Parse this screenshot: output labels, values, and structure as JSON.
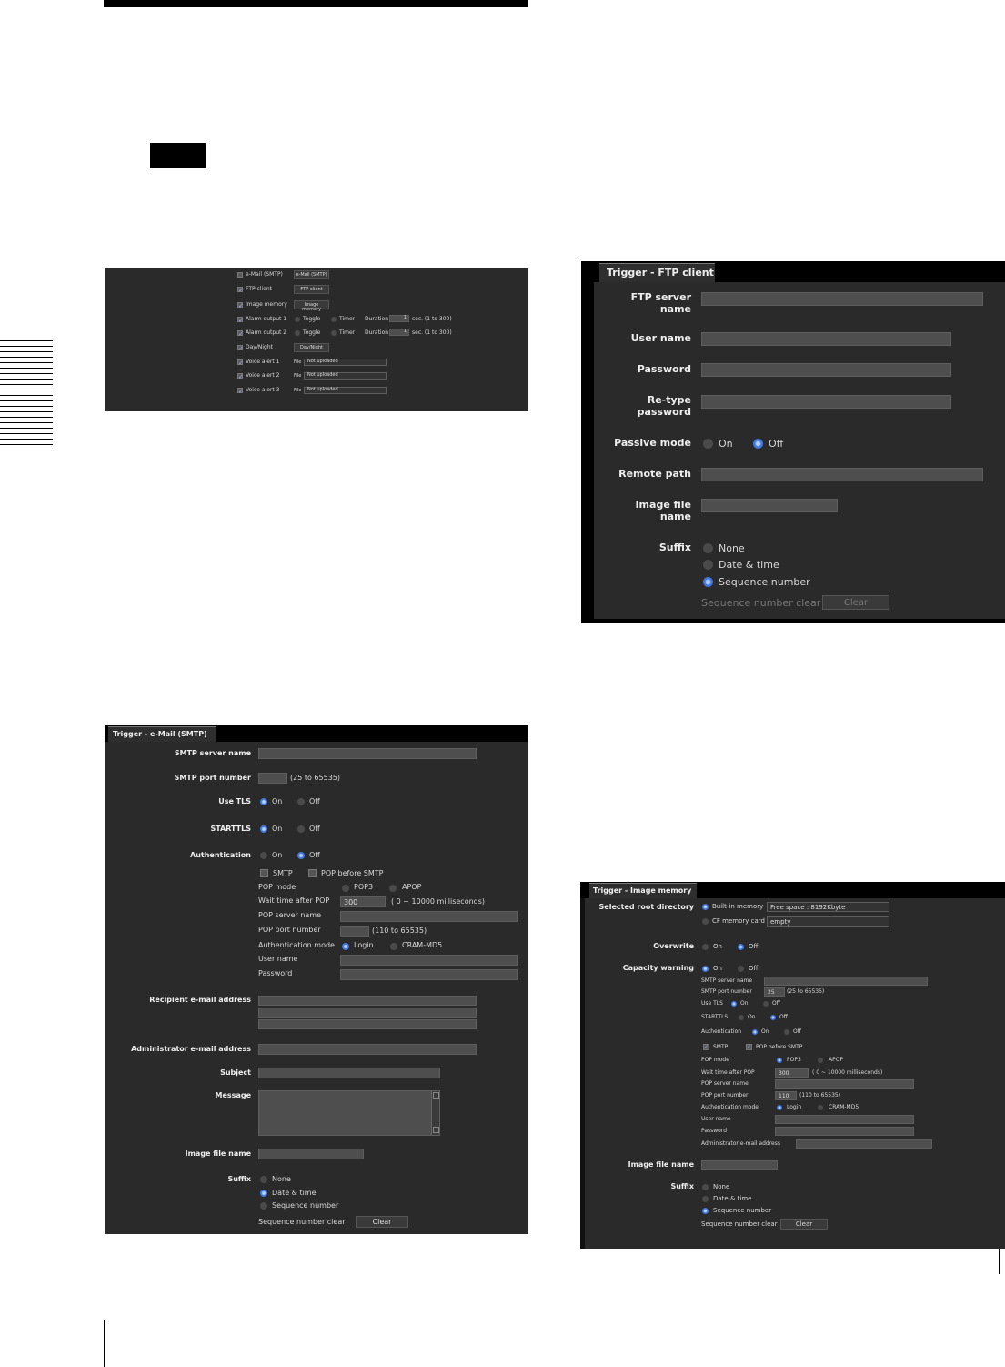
{
  "trigger_list": {
    "rows": [
      {
        "label": "e-Mail (SMTP)",
        "button": "e-Mail (SMTP)"
      },
      {
        "label": "FTP client",
        "button": "FTP client"
      },
      {
        "label": "Image memory",
        "button": "Image memory"
      },
      {
        "label": "Alarm output 1"
      },
      {
        "label": "Alarm output 2"
      },
      {
        "label": "Day/Night",
        "button": "Day/Night"
      },
      {
        "label": "Voice alert 1"
      },
      {
        "label": "Voice alert 2"
      },
      {
        "label": "Voice alert 3"
      }
    ],
    "toggle": "Toggle",
    "timer": "Timer",
    "duration": "Duration",
    "duration_value": "1",
    "duration_range": "sec. (1 to 300)",
    "file": "File",
    "not_uploaded": "Not uploaded"
  },
  "ftp": {
    "title": "Trigger - FTP client",
    "server_name": "FTP server name",
    "user_name": "User name",
    "password": "Password",
    "retype": "Re-type password",
    "passive_mode": "Passive mode",
    "on": "On",
    "off": "Off",
    "remote_path": "Remote path",
    "image_file_name": "Image file name",
    "suffix": "Suffix",
    "none": "None",
    "date_time": "Date & time",
    "sequence": "Sequence number",
    "seq_clear": "Sequence number clear",
    "clear": "Clear"
  },
  "smtp": {
    "title": "Trigger - e-Mail (SMTP)",
    "server_name": "SMTP server name",
    "port": "SMTP port number",
    "port_range": "(25 to 65535)",
    "use_tls": "Use TLS",
    "starttls": "STARTTLS",
    "authentication": "Authentication",
    "on": "On",
    "off": "Off",
    "smtp": "SMTP",
    "pop_before": "POP before SMTP",
    "pop_mode": "POP mode",
    "pop3": "POP3",
    "apop": "APOP",
    "wait": "Wait time after POP",
    "wait_value": "300",
    "wait_range": "( 0 ~ 10000 milliseconds)",
    "pop_server": "POP server name",
    "pop_port": "POP port number",
    "pop_port_range": "(110 to 65535)",
    "auth_mode": "Authentication mode",
    "login": "Login",
    "cram": "CRAM-MD5",
    "user_name": "User name",
    "password": "Password",
    "recipient": "Recipient e-mail address",
    "admin": "Administrator e-mail address",
    "subject": "Subject",
    "message": "Message",
    "image_file_name": "Image file name",
    "suffix": "Suffix",
    "none": "None",
    "date_time": "Date & time",
    "sequence": "Sequence number",
    "seq_clear": "Sequence number clear",
    "clear": "Clear"
  },
  "imgmem": {
    "title": "Trigger - Image memory",
    "root_dir": "Selected root directory",
    "builtin": "Built-in memory",
    "free_space": "Free space : 8192Kbyte",
    "cf_card": "CF memory card",
    "cf_value": "empty",
    "overwrite": "Overwrite",
    "capacity": "Capacity warning",
    "on": "On",
    "off": "Off",
    "smtp_server": "SMTP server name",
    "smtp_port": "SMTP port number",
    "smtp_port_value": "25",
    "port_range": "(25 to 65535)",
    "use_tls": "Use TLS",
    "starttls": "STARTTLS",
    "authentication": "Authentication",
    "smtp": "SMTP",
    "pop_before": "POP before SMTP",
    "pop_mode": "POP mode",
    "pop3": "POP3",
    "apop": "APOP",
    "wait": "Wait time after POP",
    "wait_value": "300",
    "wait_range": "( 0 ~ 10000 milliseconds)",
    "pop_server": "POP server name",
    "pop_port": "POP port number",
    "pop_port_value": "110",
    "pop_port_range": "(110 to 65535)",
    "auth_mode": "Authentication mode",
    "login": "Login",
    "cram": "CRAM-MD5",
    "user_name": "User name",
    "password": "Password",
    "admin": "Administrator e-mail address",
    "image_file_name": "Image file name",
    "suffix": "Suffix",
    "none": "None",
    "date_time": "Date & time",
    "sequence": "Sequence number",
    "seq_clear": "Sequence number clear",
    "clear": "Clear"
  }
}
